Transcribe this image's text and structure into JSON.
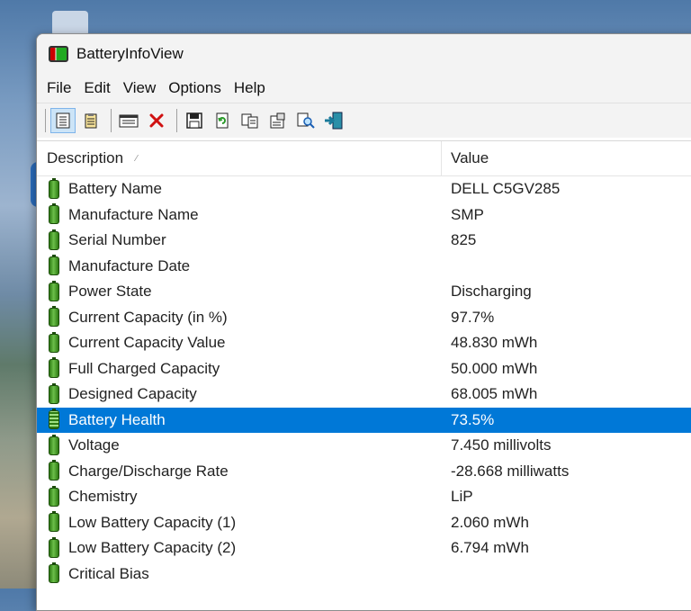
{
  "window": {
    "title": "BatteryInfoView"
  },
  "menu": [
    "File",
    "Edit",
    "View",
    "Options",
    "Help"
  ],
  "toolbar": [
    {
      "name": "html-report-icon"
    },
    {
      "name": "properties-icon"
    },
    {
      "name": "advanced-icon"
    },
    {
      "name": "delete-icon"
    },
    {
      "name": "save-icon"
    },
    {
      "name": "refresh-icon"
    },
    {
      "name": "copy-icon"
    },
    {
      "name": "properties-page-icon"
    },
    {
      "name": "find-icon"
    },
    {
      "name": "exit-icon"
    }
  ],
  "columns": {
    "description": "Description",
    "value": "Value"
  },
  "rows": [
    {
      "desc": "Battery Name",
      "value": "DELL C5GV285"
    },
    {
      "desc": "Manufacture Name",
      "value": "SMP"
    },
    {
      "desc": "Serial Number",
      "value": "825"
    },
    {
      "desc": "Manufacture Date",
      "value": ""
    },
    {
      "desc": "Power State",
      "value": "Discharging"
    },
    {
      "desc": "Current Capacity (in %)",
      "value": "97.7%"
    },
    {
      "desc": "Current Capacity Value",
      "value": "48.830 mWh"
    },
    {
      "desc": "Full Charged Capacity",
      "value": "50.000 mWh"
    },
    {
      "desc": "Designed Capacity",
      "value": "68.005 mWh"
    },
    {
      "desc": "Battery Health",
      "value": "73.5%",
      "selected": true
    },
    {
      "desc": "Voltage",
      "value": "7.450 millivolts"
    },
    {
      "desc": "Charge/Discharge Rate",
      "value": "-28.668 milliwatts"
    },
    {
      "desc": "Chemistry",
      "value": "LiP"
    },
    {
      "desc": "Low Battery Capacity (1)",
      "value": "2.060 mWh"
    },
    {
      "desc": "Low Battery Capacity (2)",
      "value": "6.794 mWh"
    },
    {
      "desc": "Critical Bias",
      "value": ""
    }
  ],
  "colors": {
    "selection": "#0078d7",
    "battery": "#2d7a12"
  }
}
